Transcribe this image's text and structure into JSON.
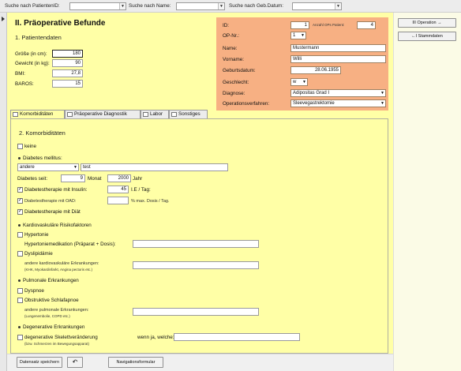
{
  "topbar": {
    "search_patient_id_label": "Suche nach PatientenID:",
    "search_name_label": "Suche nach Name:",
    "search_dob_label": "Suche nach Geb.Datum:"
  },
  "title": "II. Präoperative Befunde",
  "section1": "1. Patientendaten",
  "fields": {
    "height_label": "Größe (in cm):",
    "height_value": "180",
    "weight_label": "Gewicht (in kg):",
    "weight_value": "90",
    "bmi_label": "BMI:",
    "bmi_value": "27,8",
    "baros_label": "BAROS:",
    "baros_value": "15"
  },
  "patient": {
    "id_label": "ID:",
    "id_value": "1",
    "ops_count_label": "Anzahl OPs Patient:",
    "ops_count_value": "4",
    "opnr_label": "OP-Nr.:",
    "opnr_value": "1",
    "name_label": "Name:",
    "name_value": "Mustermann",
    "firstname_label": "Vorname:",
    "firstname_value": "Willi",
    "dob_label": "Geburtsdatum:",
    "dob_value": "28.06.1955",
    "sex_label": "Geschlecht:",
    "sex_value": "w",
    "diagnosis_label": "Diagnose:",
    "diagnosis_value": "Adipositas Grad I",
    "procedure_label": "Operationsverfahren:",
    "procedure_value": "Sleevegastrektomie"
  },
  "right_buttons": {
    "operation": "III Operation →",
    "stammdaten": "←I Stammdaten"
  },
  "tabs": [
    "Komorbiditäten",
    "Präoperative Diagnostik",
    "Labor",
    "Sonstiges"
  ],
  "panel": {
    "heading": "2. Komorbiditäten",
    "keine": "keine",
    "diabetes_heading": "Diabetes mellitus:",
    "diabetes_type": "andere",
    "diabetes_text": "test",
    "diabetes_since_label": "Diabetes seit:",
    "diabetes_month": "9",
    "month_label": "Monat",
    "diabetes_year": "2000",
    "year_label": "Jahr",
    "insulin_label": "Diabetestherapie mit Insulin:",
    "insulin_value": "45",
    "insulin_unit": "I.E / Tag:",
    "oad_label": "Diabetestherapie mit OAD:",
    "oad_unit": "% max. Dosis / Tag.",
    "diet_label": "Diabetestherapie mit Diät",
    "cardio_heading": "Kardiovaskuläre Risikofaktoren",
    "hypertonie": "Hypertonie",
    "hyper_med": "Hypertoniemedikation (Präparat + Dosis):",
    "dyslipidaemie": "Dyslipidämie",
    "other_cardio": "andere kardiovaskuläre Erkrankungen:",
    "other_cardio_hint": "(KHK, Myokardinfarkt, Angina pectoris etc.)",
    "pulm_heading": "Pulmonale Erkrankungen",
    "dyspnoe": "Dyspnoe",
    "osa": "Obstruktive Schlafapnoe",
    "other_pulm": "andere pulmonale Erkrankungen:",
    "other_pulm_hint": "(Lungenembolie, COPD etc.)",
    "degen_heading": "Degenerative Erkrankungen",
    "degen_skelett": "degenerative Skelettveränderung",
    "degen_hint": "(bzw. Schmerzen im Bewegungsapparat)",
    "wenn_ja": "wenn ja, welche:"
  },
  "bottom": {
    "save": "Datensatz speichern",
    "undo": "↶",
    "nav": "Navigationsformular"
  }
}
